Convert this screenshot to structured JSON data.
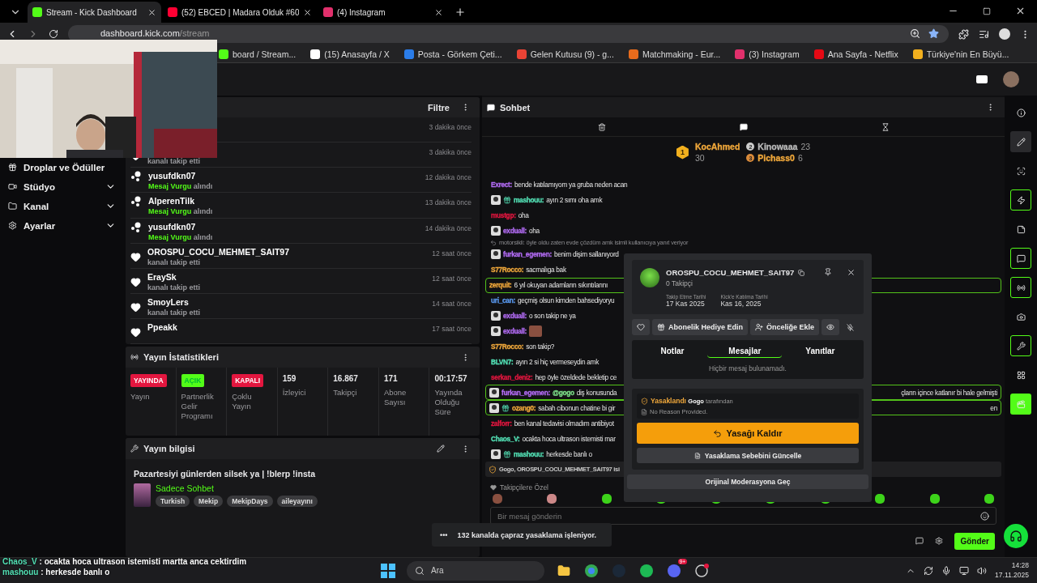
{
  "browser": {
    "tabs": [
      {
        "title": "Stream - Kick Dashboard",
        "kind": "kick",
        "selected": true
      },
      {
        "title": "(52) EBCED | Madara Olduk #60",
        "kind": "youtube",
        "selected": false
      },
      {
        "title": "(4) Instagram",
        "kind": "instagram",
        "selected": false
      }
    ],
    "url": {
      "host": "dashboard.kick.com",
      "path": "/stream"
    },
    "bookmarks": [
      {
        "title": "board / Stream...",
        "kind": "kick"
      },
      {
        "title": "(15) Anasayfa / X",
        "kind": "x"
      },
      {
        "title": "Posta - Görkem Çeti...",
        "kind": "mail"
      },
      {
        "title": "Gelen Kutusu (9) - g...",
        "kind": "gmail"
      },
      {
        "title": "Matchmaking - Eur...",
        "kind": "game"
      },
      {
        "title": "(3) Instagram",
        "kind": "instagram"
      },
      {
        "title": "Ana Sayfa - Netflix",
        "kind": "netflix"
      },
      {
        "title": "Türkiye'nin En Büyü...",
        "kind": "site"
      }
    ]
  },
  "sidebar": {
    "items": [
      {
        "label": "Droplar ve Ödüller",
        "has_submenu": false
      },
      {
        "label": "Stüdyo",
        "has_submenu": true
      },
      {
        "label": "Kanal",
        "has_submenu": true
      },
      {
        "label": "Ayarlar",
        "has_submenu": true
      }
    ]
  },
  "activity": {
    "filter": "Filtre",
    "rows": [
      {
        "kind": "follow",
        "time": "3 dakika önce"
      },
      {
        "kind": "follow",
        "action": "kanalı takip etti",
        "time": "3 dakika önce"
      },
      {
        "kind": "highlight",
        "user": "yusufdkn07",
        "highlight": "Mesaj Vurgu",
        "action": "alındı",
        "time": "12 dakika önce"
      },
      {
        "kind": "highlight",
        "user": "AlperenTilk",
        "highlight": "Mesaj Vurgu",
        "action": "alındı",
        "time": "13 dakika önce"
      },
      {
        "kind": "highlight",
        "user": "yusufdkn07",
        "highlight": "Mesaj Vurgu",
        "action": "alındı",
        "time": "14 dakika önce"
      },
      {
        "kind": "follow",
        "user": "OROSPU_COCU_MEHMET_SAIT97",
        "action": "kanalı takip etti",
        "time": "12 saat önce"
      },
      {
        "kind": "follow",
        "user": "EraySk",
        "action": "kanalı takip etti",
        "time": "12 saat önce"
      },
      {
        "kind": "follow",
        "user": "SmoyLers",
        "action": "kanalı takip etti",
        "time": "14 saat önce"
      },
      {
        "kind": "follow",
        "user": "Ppeakk",
        "time": "17 saat önce"
      }
    ]
  },
  "stats": {
    "title": "Yayın İstatistikleri",
    "items": [
      {
        "kind": "badge",
        "value": "YAYINDA",
        "color": "#e3163f",
        "label": "Yayın"
      },
      {
        "kind": "badge",
        "value": "AÇIK",
        "color": "#53fc18",
        "label": "Partnerlik Gelir Programı"
      },
      {
        "kind": "badge",
        "value": "KAPALI",
        "color": "#e3163f",
        "label": "Çoklu Yayın"
      },
      {
        "kind": "number",
        "value": "159",
        "label": "İzleyici"
      },
      {
        "kind": "number",
        "value": "16.867",
        "label": "Takipçi"
      },
      {
        "kind": "number",
        "value": "171",
        "label": "Abone Sayısı"
      },
      {
        "kind": "number",
        "value": "00:17:57",
        "label": "Yayında Olduğu Süre"
      }
    ]
  },
  "stream_info": {
    "title": "Yayın bilgisi",
    "stream_title": "Pazartesiyi günlerden silsek ya | !blerp !insta",
    "category": "Sadece Sohbet",
    "tags": [
      "Turkish",
      "Mekip",
      "MekipDays",
      "aileyayını"
    ]
  },
  "chat": {
    "title": "Sohbet",
    "leaderboard": [
      {
        "rank": "1",
        "user": "KocAhmed",
        "count": "30"
      },
      {
        "rank": "2",
        "user": "Kinowaaa",
        "count": "23"
      },
      {
        "rank": "3",
        "user": "Pichass0",
        "count": "6"
      }
    ],
    "messages": [
      {
        "kind": "message",
        "user": "Exrect:",
        "color": "#b36cf5",
        "avatar": false,
        "sub": false,
        "highlighted": false,
        "text": "bende katılamıyom ya gruba neden acan"
      },
      {
        "kind": "message",
        "user": "mashouu:",
        "color": "#53e0b5",
        "avatar": true,
        "sub": true,
        "highlighted": false,
        "text": "ayın 2 sımı oha amk"
      },
      {
        "kind": "message",
        "user": "mustgp:",
        "color": "#e3163f",
        "avatar": false,
        "sub": false,
        "highlighted": false,
        "text": "oha"
      },
      {
        "kind": "message",
        "user": "exduall:",
        "color": "#b36cf5",
        "avatar": true,
        "sub": false,
        "highlighted": false,
        "text": "oha"
      },
      {
        "kind": "reply",
        "text": "motorsikli: öyle oldu zaten evde çözdüm amk isimli kullanıcıya yanıt veriyor"
      },
      {
        "kind": "message",
        "user": "furkan_egemen:",
        "color": "#b36cf5",
        "avatar": true,
        "sub": false,
        "highlighted": false,
        "text": "benim dişim sallanıyord"
      },
      {
        "kind": "message",
        "user": "S77Rocco:",
        "color": "#f2a93b",
        "avatar": false,
        "sub": false,
        "highlighted": false,
        "text": "sacmalıga bak"
      },
      {
        "kind": "message",
        "user": "zerquit:",
        "color": "#f2a93b",
        "avatar": false,
        "sub": false,
        "highlighted": true,
        "text": "6 yıl okuyan adamların sıkıntılarını"
      },
      {
        "kind": "message",
        "user": "uri_can:",
        "color": "#5b9cf5",
        "avatar": false,
        "sub": false,
        "highlighted": false,
        "text": "geçmiş olsun kimden bahsediyoryu"
      },
      {
        "kind": "message",
        "user": "exduall:",
        "color": "#b36cf5",
        "avatar": true,
        "sub": false,
        "highlighted": false,
        "text": "o son takip ne ya"
      },
      {
        "kind": "message",
        "user": "exduall:",
        "color": "#b36cf5",
        "avatar": true,
        "sub": false,
        "highlighted": false,
        "emote": true
      },
      {
        "kind": "message",
        "user": "S77Rocco:",
        "color": "#f2a93b",
        "avatar": false,
        "sub": false,
        "highlighted": false,
        "text": "son takip?"
      },
      {
        "kind": "message",
        "user": "BLVN7:",
        "color": "#53e0b5",
        "avatar": false,
        "sub": false,
        "highlighted": false,
        "text": "ayın 2 si hiç vermeseydin amk"
      },
      {
        "kind": "message",
        "user": "serkan_deniz:",
        "color": "#e3163f",
        "avatar": false,
        "sub": false,
        "highlighted": false,
        "text": "hep öyle özeldede bekletip ce"
      },
      {
        "kind": "message",
        "user": "furkan_egemen:",
        "color": "#b36cf5",
        "avatar": true,
        "sub": false,
        "highlighted": true,
        "mention": "@gogo",
        "text": "diş konusunda",
        "tail": "çların içince katlanır bi hale gelmişti"
      },
      {
        "kind": "message",
        "user": "ozang0:",
        "color": "#f2a93b",
        "avatar": true,
        "sub": true,
        "highlighted": true,
        "text": "sabah cibonun chatine bi gir",
        "tail": "en"
      },
      {
        "kind": "message",
        "user": "zalforr:",
        "color": "#e3163f",
        "avatar": false,
        "sub": false,
        "highlighted": false,
        "text": "ben kanal tedavisi olmadım antibiyot"
      },
      {
        "kind": "message",
        "user": "Chaos_V:",
        "color": "#53e0b5",
        "avatar": false,
        "sub": false,
        "highlighted": false,
        "text": "ocakta hoca ultrason istemisti mar"
      },
      {
        "kind": "message",
        "user": "mashouu:",
        "color": "#53e0b5",
        "avatar": true,
        "sub": true,
        "highlighted": false,
        "text": "herkesde banlı o"
      },
      {
        "kind": "system",
        "text": "Gogo, OROSPU_COCU_MEHMET_SAIT97 isi"
      }
    ],
    "followers_only": "Takipçilere Özel",
    "input_placeholder": "Bir mesaj gönderin",
    "send": "Gönder"
  },
  "user_card": {
    "name": "OROSPU_COCU_MEHMET_SAIT97",
    "followers": "0 Takipçi",
    "dates": [
      {
        "label": "Takip Etme Tarihi",
        "value": "17 Kas 2025"
      },
      {
        "label": "Kick'e Katılma Tarihi",
        "value": "Kas 16, 2025"
      }
    ],
    "actions": [
      "Abonelik Hediye Edin",
      "Önceliğe Ekle"
    ],
    "tabs": [
      {
        "label": "Notlar",
        "selected": false
      },
      {
        "label": "Mesajlar",
        "selected": true
      },
      {
        "label": "Yanıtlar",
        "selected": false
      }
    ],
    "empty": "Hiçbir mesaj bulunamadı.",
    "ban": {
      "status": "Yasaklandı",
      "by": "Gogo",
      "by_suffix": "tarafından",
      "reason": "No Reason Provided."
    },
    "unban": "Yasağı Kaldır",
    "update_reason": "Yasaklama Sebebini Güncelle",
    "original": "Orijinal Moderasyona Geç"
  },
  "toast": {
    "dots": "•••",
    "text": "132 kanalda çapraz yasaklama işleniyor."
  },
  "rail": [
    {
      "selected": false,
      "outlined": false
    },
    {
      "selected": true,
      "outlined": false
    },
    {
      "selected": false,
      "outlined": false
    },
    {
      "selected": false,
      "outlined": true
    },
    {
      "selected": false,
      "outlined": false
    },
    {
      "selected": false,
      "outlined": true
    },
    {
      "selected": false,
      "outlined": true
    },
    {
      "selected": false,
      "outlined": false
    },
    {
      "selected": false,
      "outlined": true
    },
    {
      "selected": false,
      "outlined": false
    },
    {
      "selected": false,
      "outlined": false
    }
  ],
  "overlay_chat": [
    {
      "user": "Chaos_V",
      "text": ": ocakta hoca ultrason istemisti martta anca cektirdim"
    },
    {
      "user": "mashouu",
      "text": ": herkesde banlı o"
    }
  ],
  "taskbar": {
    "search": "Ara",
    "discord_badge": "9+",
    "time": "14:28",
    "date": "17.11.2025"
  }
}
